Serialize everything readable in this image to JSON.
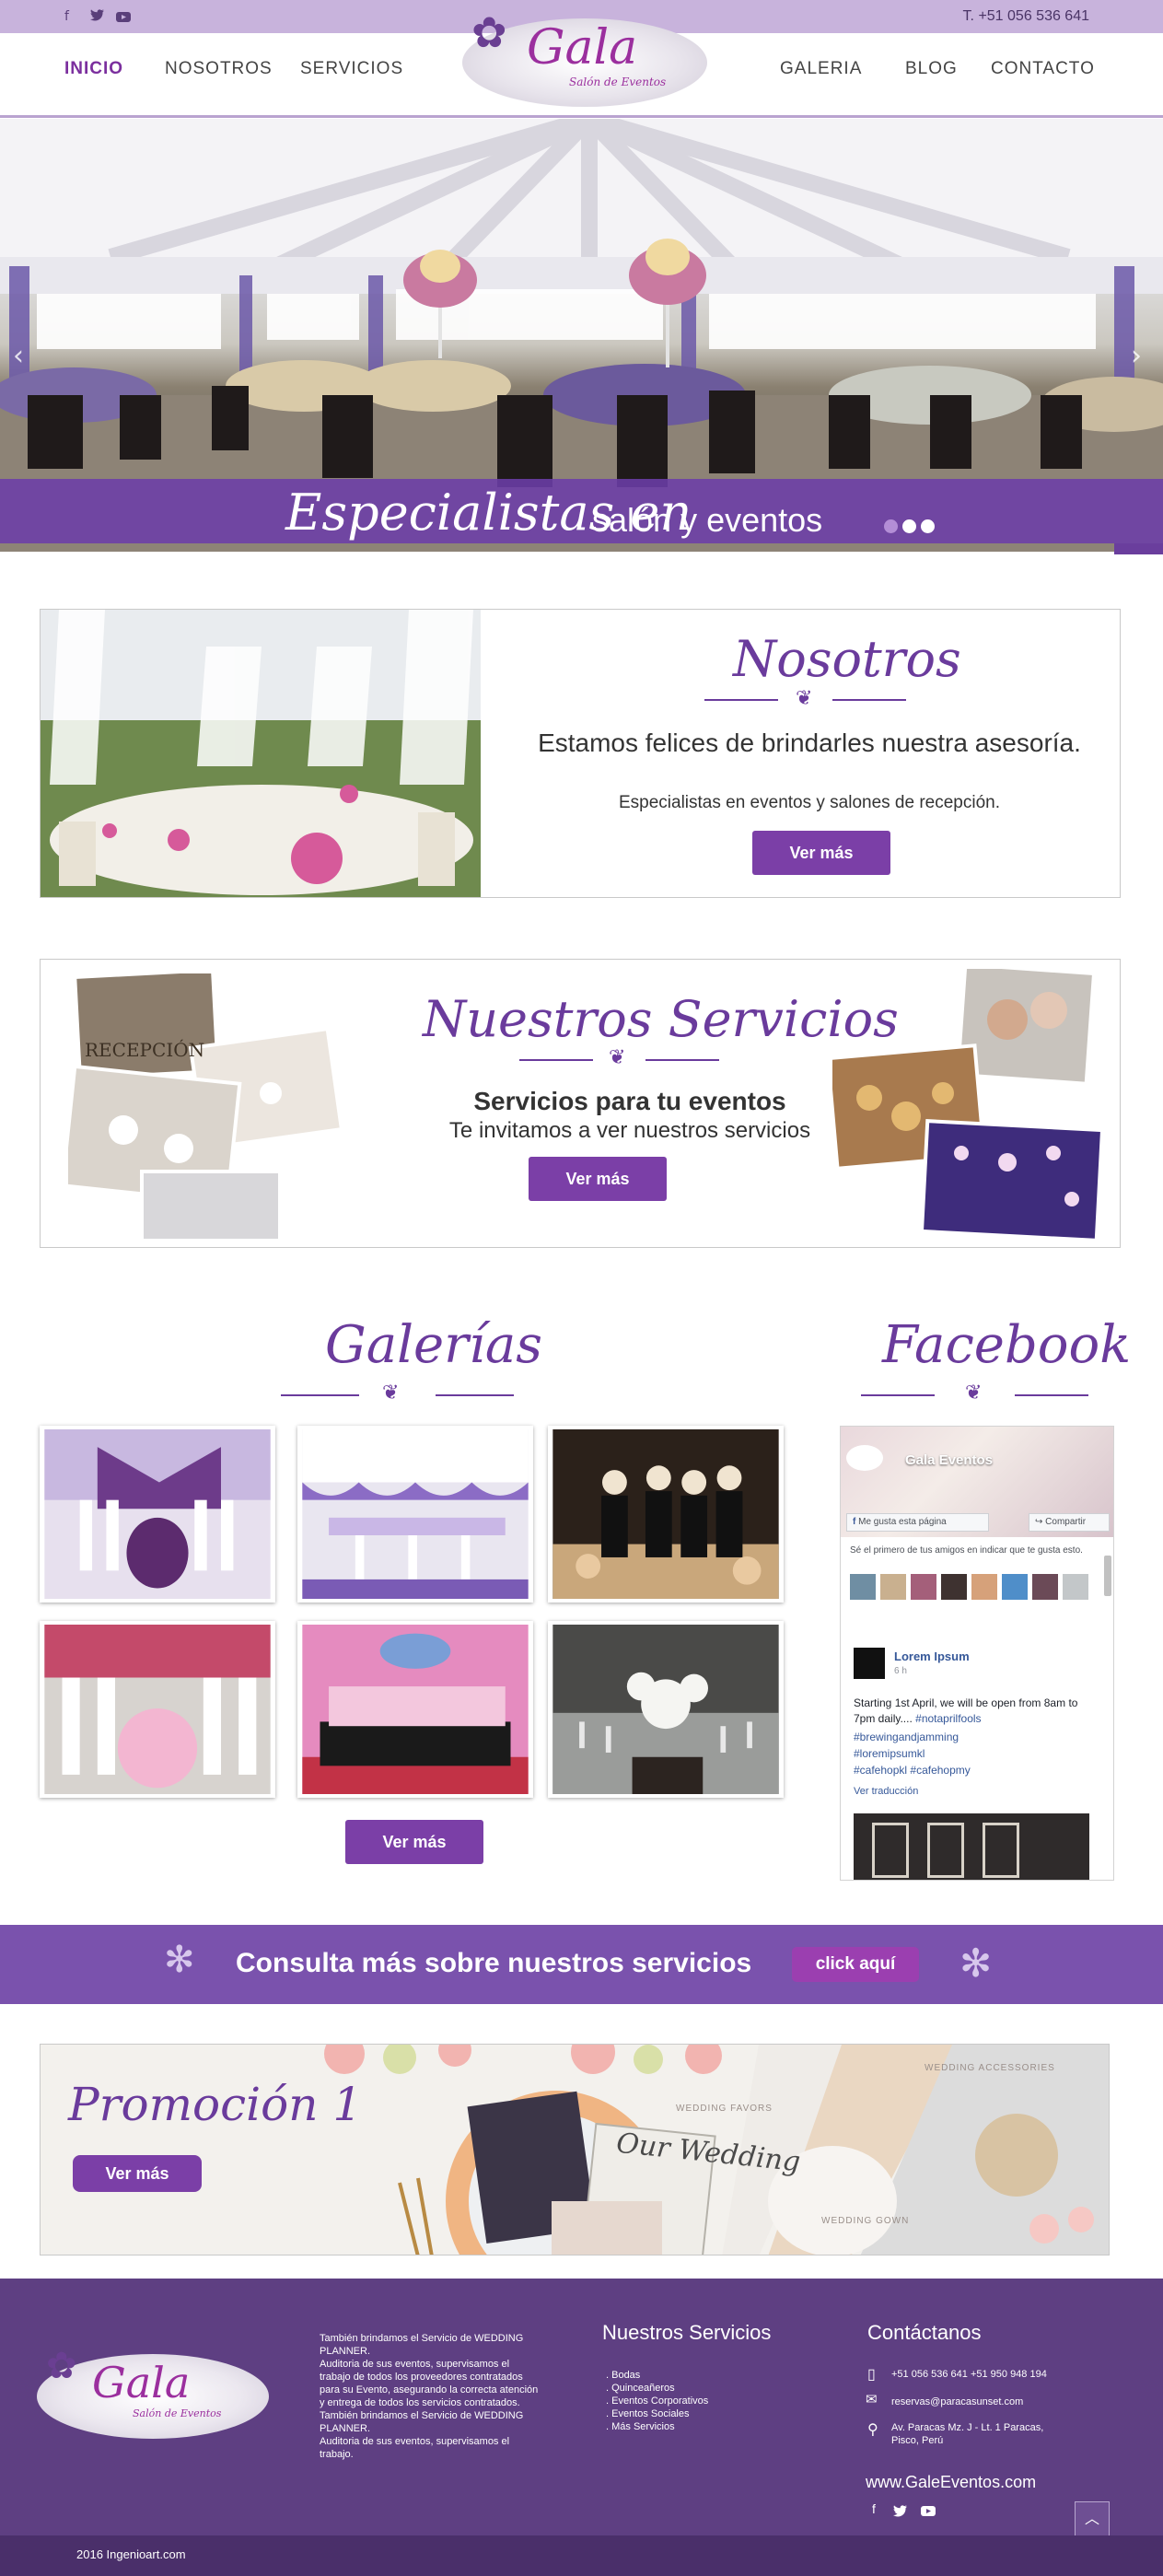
{
  "topbar": {
    "social_icons": [
      "facebook-icon",
      "twitter-icon",
      "youtube-icon"
    ],
    "phone": "T. +51 056 536 641"
  },
  "nav": {
    "items": [
      "INICIO",
      "NOSOTROS",
      "SERVICIOS",
      "GALERIA",
      "BLOG",
      "CONTACTO"
    ],
    "active": "INICIO",
    "logo_name": "Gala",
    "logo_sub": "Salón de Eventos"
  },
  "hero": {
    "script": "Especialistas en",
    "plain": "salón y eventos",
    "slide_count": 3
  },
  "nosotros": {
    "title": "Nosotros",
    "heading": "Estamos felices de brindarles nuestra asesoría.",
    "text": "Especialistas en eventos y salones de recepción.",
    "button": "Ver más"
  },
  "servicios": {
    "title": "Nuestros Servicios",
    "heading": "Servicios para tu eventos",
    "text": "Te invitamos a ver nuestros servicios",
    "button": "Ver más",
    "photo_caption": "RECEPCIÓN"
  },
  "galerias": {
    "title": "Galerías",
    "button": "Ver más"
  },
  "facebook": {
    "title": "Facebook",
    "page_name": "Gala Eventos",
    "like_label": "Me gusta esta página",
    "share_label": "Compartir",
    "friends_text": "Sé el primero de tus amigos en indicar que te gusta esto.",
    "post_author": "Lorem Ipsum",
    "post_time": "6 h",
    "post_text": "Starting 1st April, we will be open from 8am to 7pm daily....",
    "post_tag": "#notaprilfools",
    "hashtags": [
      "#brewingandjamming",
      "#loremipsumkl",
      "#cafehopkl",
      "#cafehopmy"
    ],
    "translate": "Ver traducción"
  },
  "consulta": {
    "text": "Consulta más sobre nuestros servicios",
    "button": "click aquí"
  },
  "promo": {
    "title": "Promoción 1",
    "button": "Ver más",
    "labels": [
      "WEDDING FAVORS",
      "WEDDING ACCESSORIES",
      "WEDDING GOWN"
    ],
    "card_text": "Our Wedding"
  },
  "footer": {
    "about_lines": [
      "También brindamos el Servicio de WEDDING",
      "PLANNER.",
      "Auditoria de sus eventos, supervisamos el",
      "trabajo de todos los proveedores contratados",
      "para su Evento, asegurando la correcta atención",
      "y entrega de todos los servicios contratados.",
      "También brindamos el Servicio de WEDDING",
      "PLANNER.",
      "Auditoria de sus eventos, supervisamos el",
      "trabajo."
    ],
    "services_title": "Nuestros Servicios",
    "services": [
      ". Bodas",
      ". Quinceañeros",
      ". Eventos Corporativos",
      ". Eventos Sociales",
      ". Más Servicios"
    ],
    "contact_title": "Contáctanos",
    "phone": "+51 056 536 641  +51 950 948 194",
    "email": "reservas@paracasunset.com",
    "address_1": "Av. Paracas Mz. J - Lt. 1 Paracas,",
    "address_2": "Pisco, Perú",
    "website": "www.GaleEventos.com",
    "copyright": "2016 Ingenioart.com"
  }
}
